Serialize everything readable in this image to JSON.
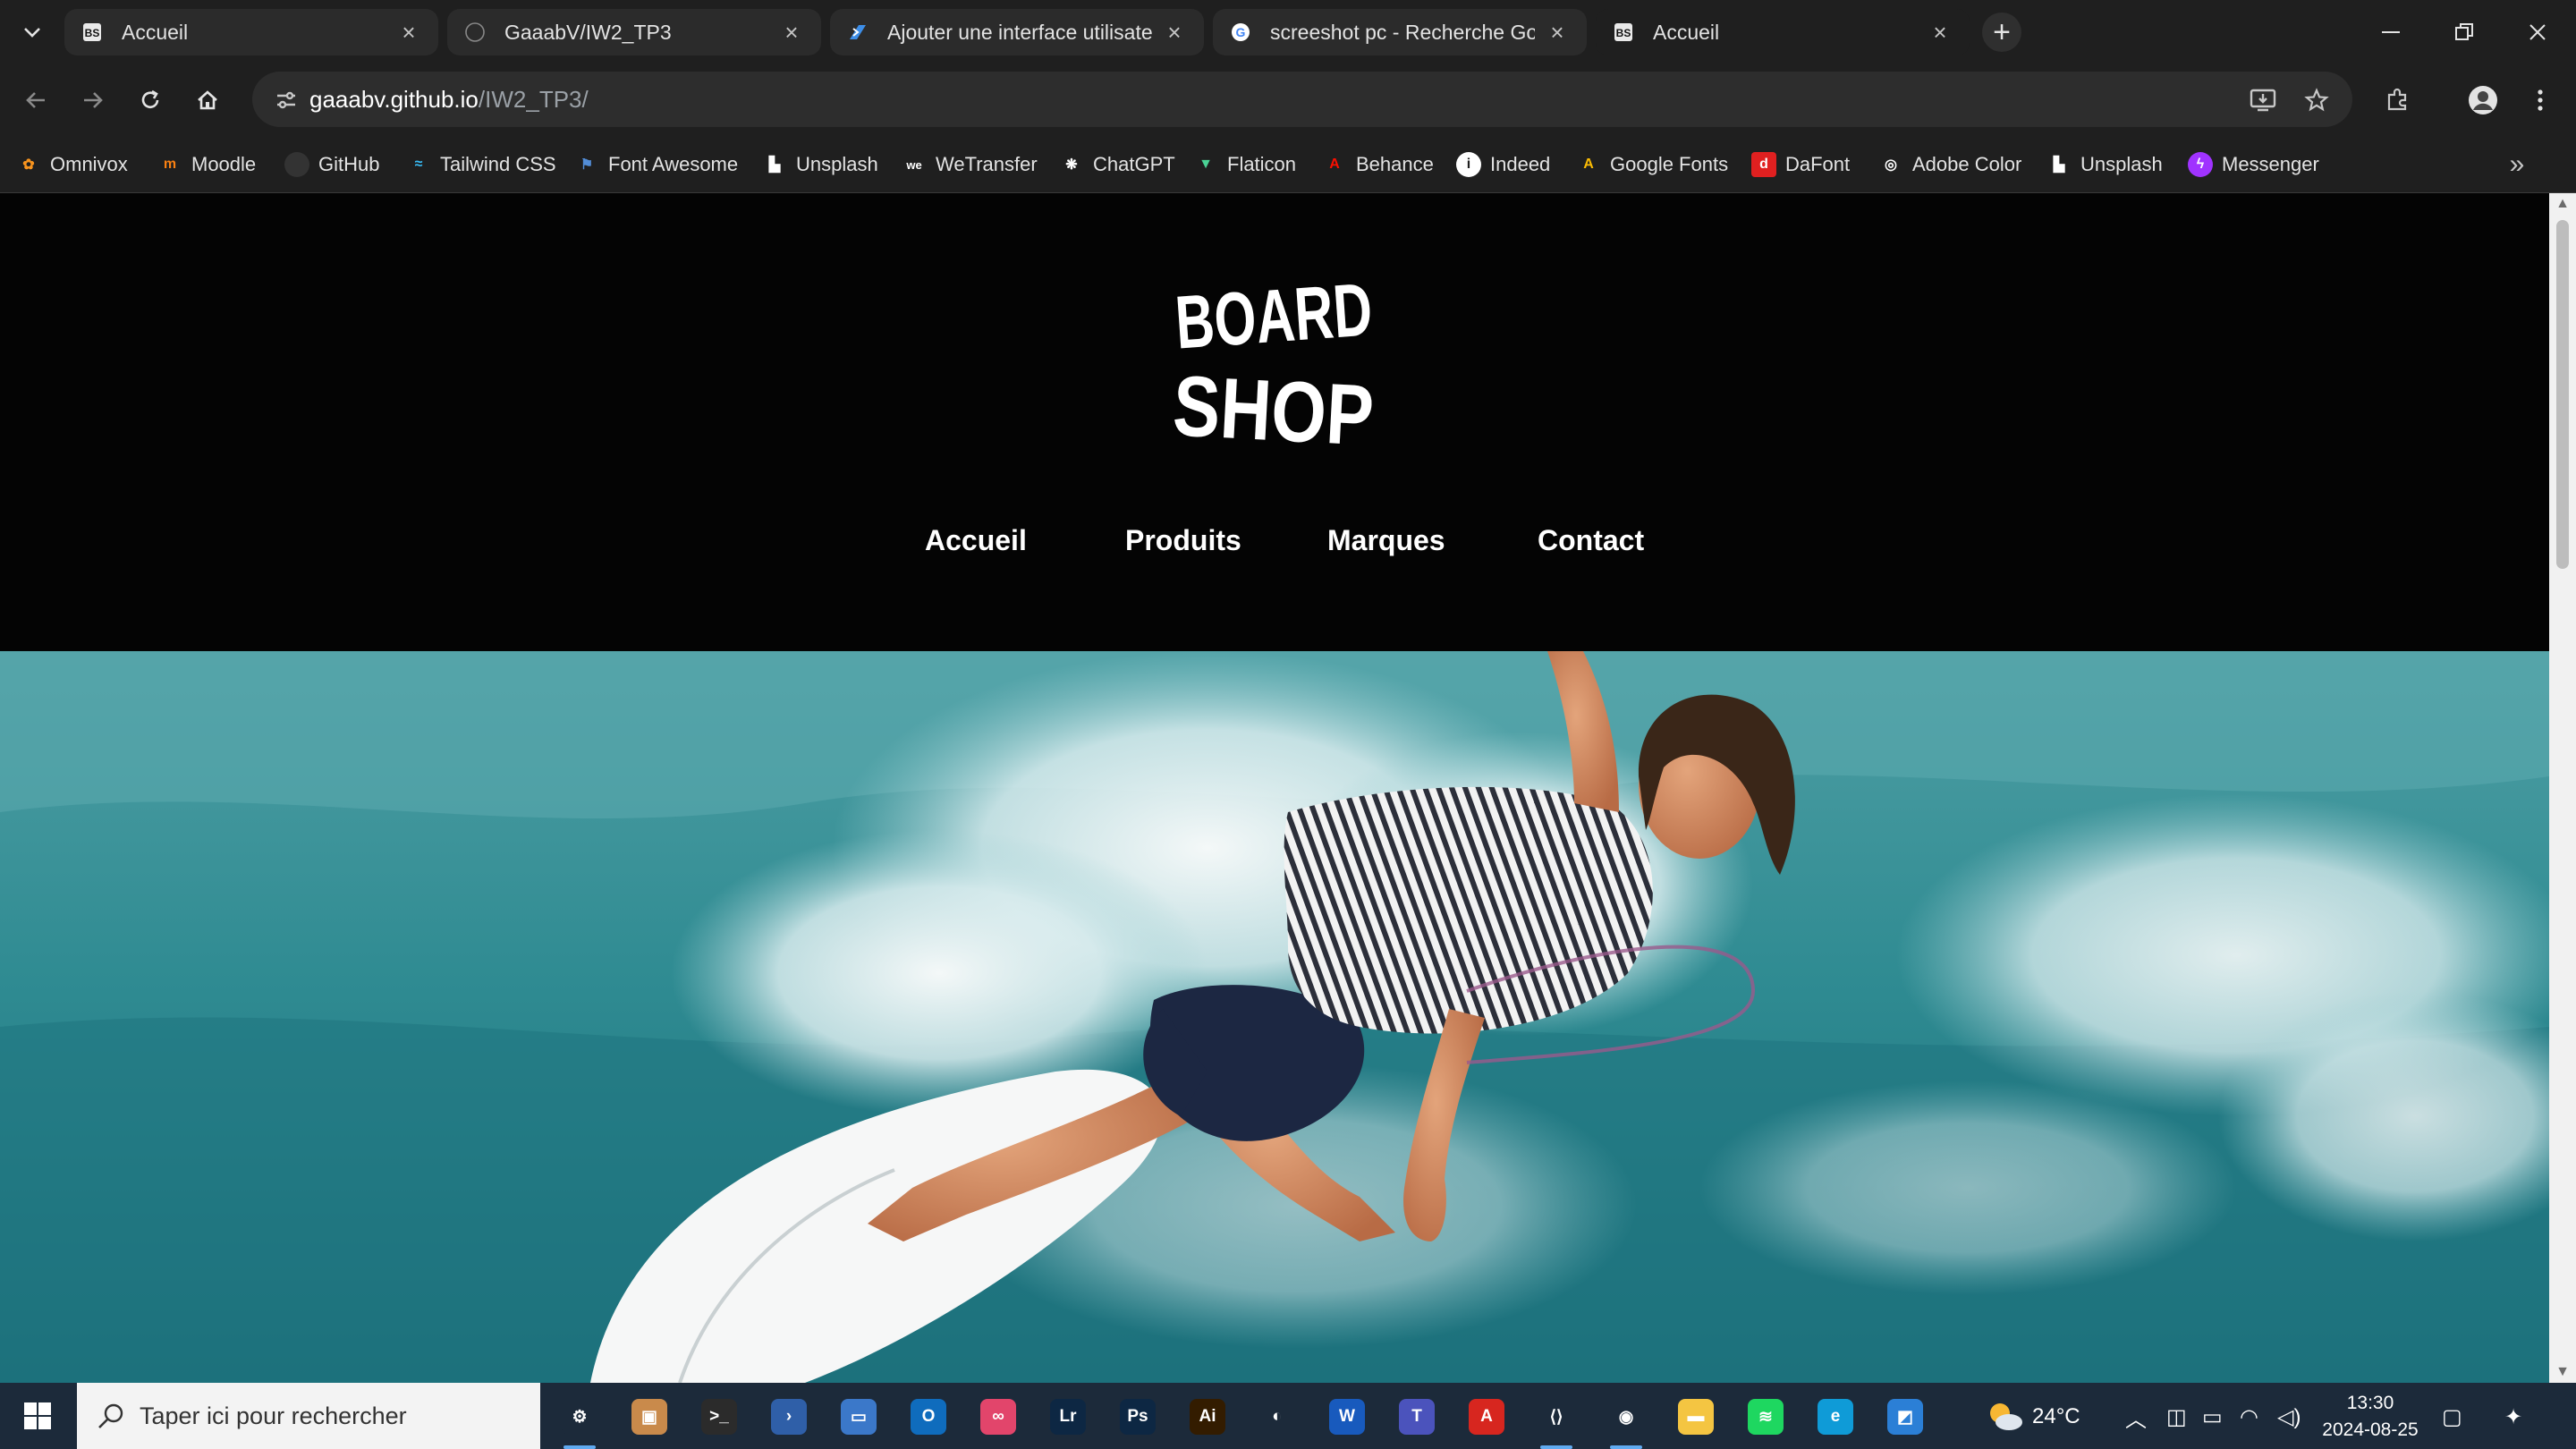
{
  "browser": {
    "tabs": [
      {
        "title": "Accueil",
        "favicon": "boardshop-favicon",
        "active": false
      },
      {
        "title": "GaaabV/IW2_TP3",
        "favicon": "github-icon",
        "active": false
      },
      {
        "title": "Ajouter une interface utilisateur",
        "favicon": "powershell-icon",
        "active": false
      },
      {
        "title": "screeshot pc - Recherche Google",
        "favicon": "google-icon",
        "active": false
      },
      {
        "title": "Accueil",
        "favicon": "boardshop-favicon",
        "active": true
      }
    ],
    "url_host": "gaaabv.github.io",
    "url_path": "/IW2_TP3/"
  },
  "bookmarks": [
    {
      "label": "Omnivox",
      "icon": "omnivox-icon",
      "color": "#f7931e"
    },
    {
      "label": "Moodle",
      "icon": "moodle-icon",
      "color": "#f98012"
    },
    {
      "label": "GitHub",
      "icon": "github-icon",
      "color": "#24292f"
    },
    {
      "label": "Tailwind CSS",
      "icon": "tailwind-icon",
      "color": "#38bdf8"
    },
    {
      "label": "Font Awesome",
      "icon": "flag-icon",
      "color": "#528dd7"
    },
    {
      "label": "Unsplash",
      "icon": "unsplash-icon",
      "color": "#ffffff"
    },
    {
      "label": "WeTransfer",
      "icon": "wetransfer-icon",
      "color": "#ffffff"
    },
    {
      "label": "ChatGPT",
      "icon": "chatgpt-icon",
      "color": "#ffffff"
    },
    {
      "label": "Flaticon",
      "icon": "flaticon-icon",
      "color": "#4ad295"
    },
    {
      "label": "Behance",
      "icon": "adobe-icon",
      "color": "#fa0f00"
    },
    {
      "label": "Indeed",
      "icon": "info-icon",
      "color": "#ffffff"
    },
    {
      "label": "Google Fonts",
      "icon": "google-fonts-icon",
      "color": "#fbbc04"
    },
    {
      "label": "DaFont",
      "icon": "dafont-icon",
      "color": "#e02020"
    },
    {
      "label": "Adobe Color",
      "icon": "adobe-color-icon",
      "color": "#ffffff"
    },
    {
      "label": "Unsplash",
      "icon": "unsplash-icon",
      "color": "#ffffff"
    },
    {
      "label": "Messenger",
      "icon": "messenger-icon",
      "color": "#a033ff"
    }
  ],
  "site": {
    "logo_text": [
      "BOARD",
      "SHOP"
    ],
    "nav": [
      "Accueil",
      "Produits",
      "Marques",
      "Contact"
    ]
  },
  "taskbar": {
    "search_placeholder": "Taper ici pour rechercher",
    "apps": [
      {
        "name": "settings-app",
        "label": "⚙",
        "color": "#1c2a3a",
        "running": true
      },
      {
        "name": "file-manager-app",
        "label": "▣",
        "color": "#c98a4b",
        "running": false
      },
      {
        "name": "terminal-app",
        "label": ">_",
        "color": "#2b2b2b",
        "running": false
      },
      {
        "name": "powershell-app",
        "label": "›",
        "color": "#2f5fa8",
        "running": false
      },
      {
        "name": "remote-desktop-app",
        "label": "▭",
        "color": "#3b78c9",
        "running": false
      },
      {
        "name": "outlook-app",
        "label": "O",
        "color": "#0f6cbd",
        "running": false
      },
      {
        "name": "creative-cloud-app",
        "label": "∞",
        "color": "#e2456b",
        "running": false
      },
      {
        "name": "lightroom-app",
        "label": "Lr",
        "color": "#0d2743",
        "running": false
      },
      {
        "name": "photoshop-app",
        "label": "Ps",
        "color": "#0d2743",
        "running": false
      },
      {
        "name": "illustrator-app",
        "label": "Ai",
        "color": "#331c00",
        "running": false
      },
      {
        "name": "copilot-app",
        "label": "◐",
        "color": "#1c2a3a",
        "running": false
      },
      {
        "name": "word-app",
        "label": "W",
        "color": "#185abd",
        "running": false
      },
      {
        "name": "teams-app",
        "label": "T",
        "color": "#4b53bc",
        "running": false
      },
      {
        "name": "acrobat-app",
        "label": "A",
        "color": "#d7261f",
        "running": false
      },
      {
        "name": "vscode-app",
        "label": "⟨⟩",
        "color": "#1c2a3a",
        "running": true
      },
      {
        "name": "chrome-app",
        "label": "◉",
        "color": "#1c2a3a",
        "running": true
      },
      {
        "name": "explorer-app",
        "label": "▬",
        "color": "#f4c542",
        "running": false
      },
      {
        "name": "spotify-app",
        "label": "≋",
        "color": "#1ed760",
        "running": false
      },
      {
        "name": "edge-app",
        "label": "e",
        "color": "#0f9bd7",
        "running": false
      },
      {
        "name": "photos-app",
        "label": "◩",
        "color": "#2b7fd6",
        "running": false
      }
    ],
    "weather": "24°C",
    "time": "13:30",
    "date": "2024-08-25"
  }
}
